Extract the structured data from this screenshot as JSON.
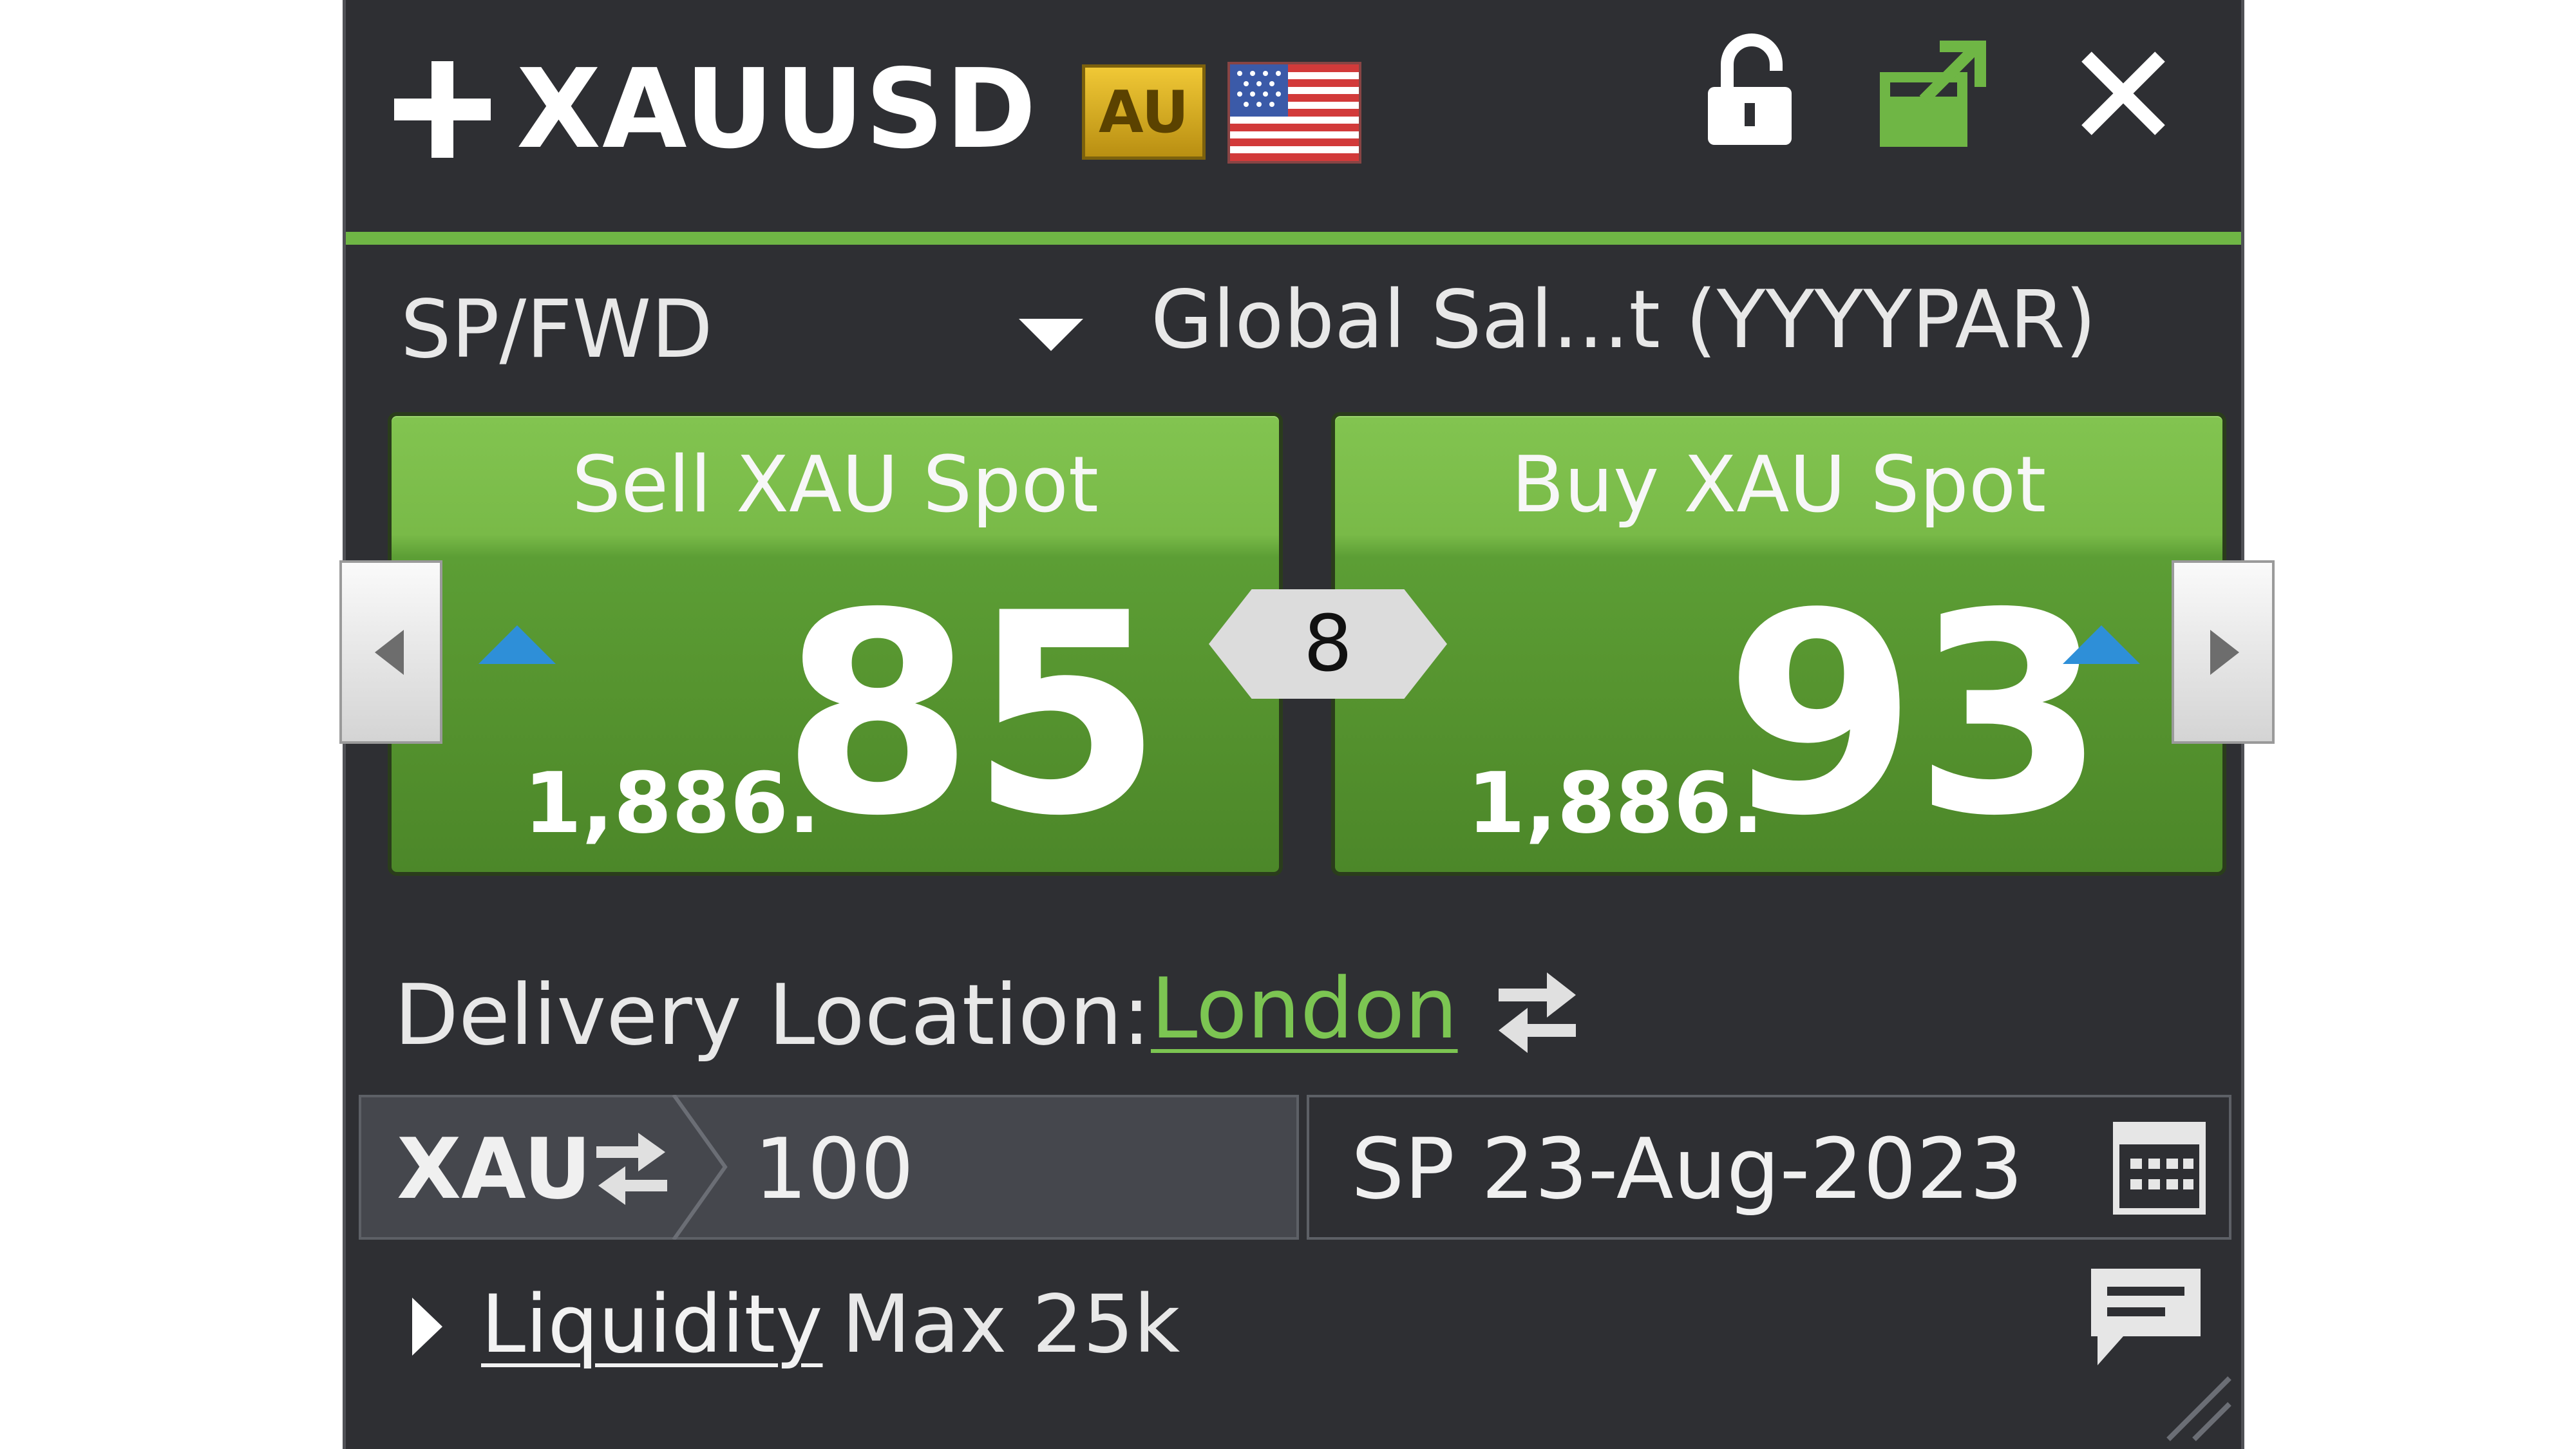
{
  "header": {
    "symbol": "XAUUSD",
    "metal_badge": "AU",
    "flag": "us-flag-icon",
    "icons": [
      "plus-icon",
      "unlock-icon",
      "popout-icon",
      "close-icon"
    ]
  },
  "colors": {
    "accent_green": "#6fb645",
    "tile_green": "#5c9e35",
    "tick_up_blue": "#2e8fd8",
    "panel_bg": "#2e2f33"
  },
  "product": {
    "type": "SP/FWD",
    "account": "Global Sal...t (YYYYPAR)"
  },
  "sell": {
    "label": "Sell XAU Spot",
    "big_figure": "1,886.",
    "pips": "85",
    "tick_direction": "up"
  },
  "buy": {
    "label": "Buy XAU Spot",
    "big_figure": "1,886.",
    "pips": "93",
    "tick_direction": "up"
  },
  "spread": "8",
  "delivery": {
    "label": "Delivery Location:",
    "value": "London"
  },
  "order": {
    "currency": "XAU",
    "amount": "100",
    "settlement": "SP 23-Aug-2023"
  },
  "footer": {
    "liquidity_label": "Liquidity",
    "liquidity_value": "Max 25k"
  }
}
